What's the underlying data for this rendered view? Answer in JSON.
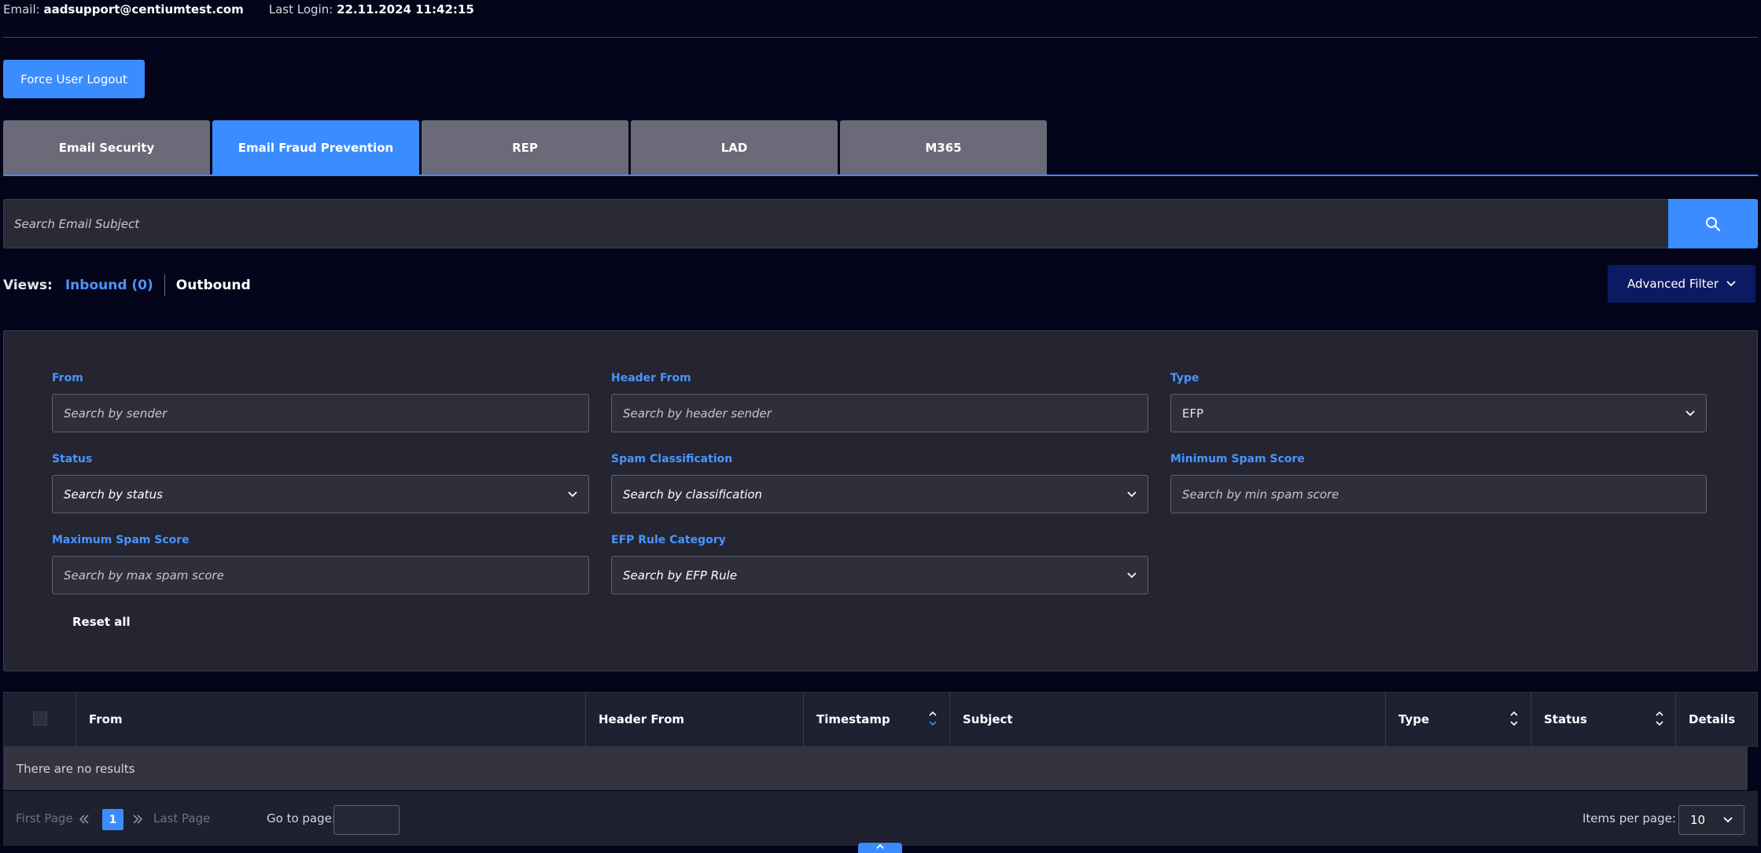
{
  "header": {
    "email_label": "Email:",
    "email_value": "aadsupport@centiumtest.com",
    "last_login_label": "Last Login:",
    "last_login_value": "22.11.2024  11:42:15"
  },
  "force_logout_label": "Force User Logout",
  "tabs": [
    {
      "label": "Email Security"
    },
    {
      "label": "Email Fraud Prevention"
    },
    {
      "label": "REP"
    },
    {
      "label": "LAD"
    },
    {
      "label": "M365"
    }
  ],
  "search": {
    "placeholder": "Search Email Subject"
  },
  "views": {
    "label": "Views:",
    "inbound": "Inbound (0)",
    "outbound": "Outbound"
  },
  "advanced_filter_label": "Advanced Filter",
  "filters": {
    "from": {
      "label": "From",
      "placeholder": "Search by sender"
    },
    "header_from": {
      "label": "Header From",
      "placeholder": "Search by header sender"
    },
    "type": {
      "label": "Type",
      "value": "EFP"
    },
    "status": {
      "label": "Status",
      "value": "Search by status"
    },
    "spam_classification": {
      "label": "Spam Classification",
      "value": "Search by classification"
    },
    "min_spam": {
      "label": "Minimum Spam Score",
      "placeholder": "Search by min spam score"
    },
    "max_spam": {
      "label": "Maximum Spam Score",
      "placeholder": "Search by max spam score"
    },
    "efp_rule": {
      "label": "EFP Rule Category",
      "value": "Search by EFP Rule"
    },
    "reset_label": "Reset all"
  },
  "table": {
    "columns": {
      "from": "From",
      "header_from": "Header From",
      "timestamp": "Timestamp",
      "subject": "Subject",
      "type": "Type",
      "status": "Status",
      "details": "Details"
    },
    "empty_text": "There are no results"
  },
  "pager": {
    "first": "First Page",
    "current": "1",
    "last": "Last Page",
    "goto_label": "Go to page:",
    "items_label": "Items per page:",
    "items_value": "10"
  },
  "colors": {
    "accent": "#3b8cff",
    "background": "#04051a",
    "advanced_button": "#0c1a63"
  }
}
